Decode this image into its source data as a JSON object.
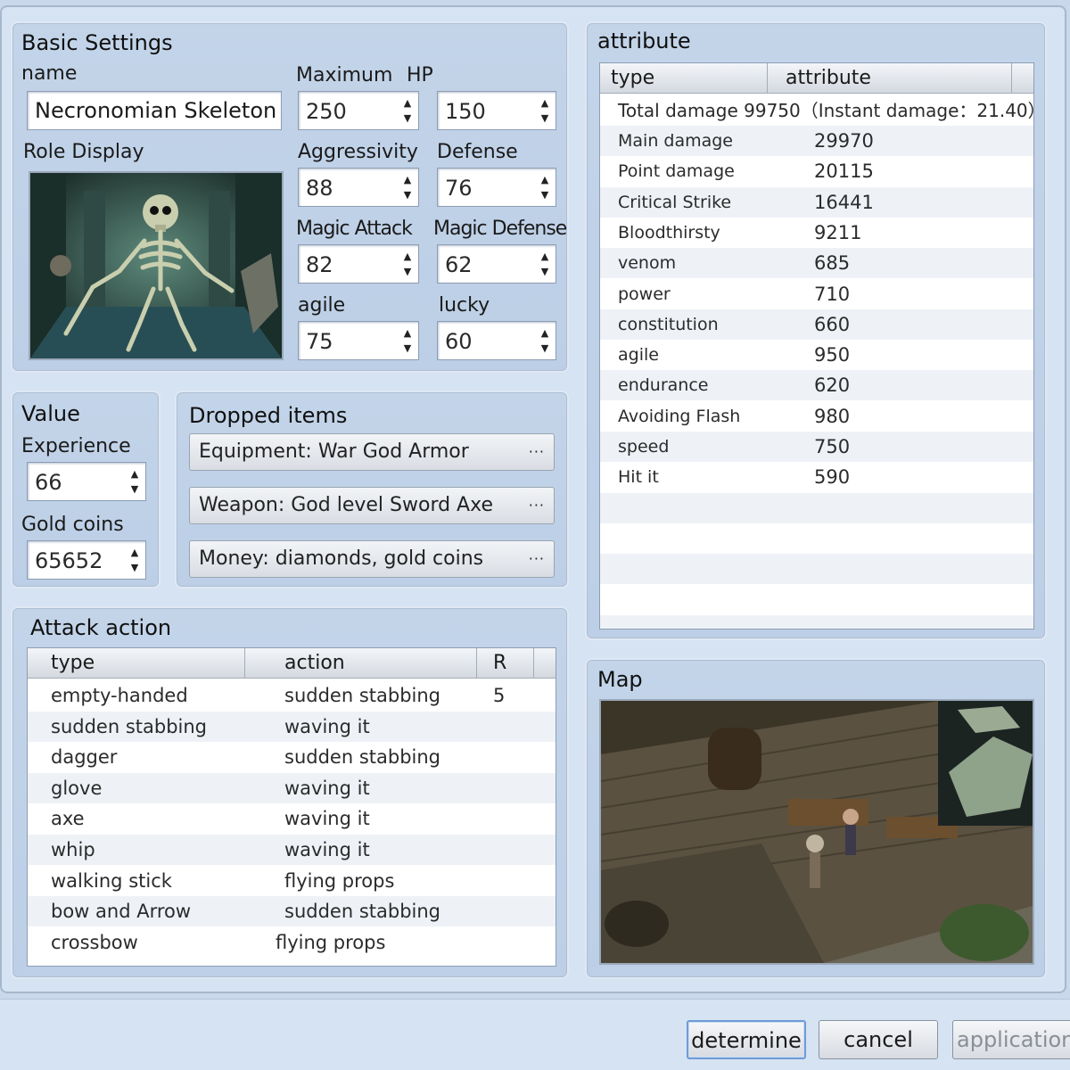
{
  "basic_settings": {
    "title": "Basic Settings",
    "name_label": "name",
    "name_value": "Necronomian Skeleton",
    "role_display_label": "Role Display",
    "maximum_label": "Maximum",
    "hp_label": "HP",
    "maximum_value": "250",
    "hp_value": "150",
    "aggressivity_label": "Aggressivity",
    "aggressivity_value": "88",
    "defense_label": "Defense",
    "defense_value": "76",
    "magic_attack_label": "Magic Attack",
    "magic_attack_value": "82",
    "magic_defense_label": "Magic Defense",
    "magic_defense_value": "62",
    "agile_label": "agile",
    "agile_value": "75",
    "lucky_label": "lucky",
    "lucky_value": "60"
  },
  "value": {
    "title": "Value",
    "experience_label": "Experience",
    "experience_value": "66",
    "gold_label": "Gold coins",
    "gold_value": "65652"
  },
  "dropped_items": {
    "title": "Dropped items",
    "items": [
      "Equipment: War God Armor",
      "Weapon: God level Sword Axe",
      "Money: diamonds, gold coins"
    ],
    "more_label": "···"
  },
  "attack_action": {
    "title": "Attack action",
    "columns": [
      "type",
      "action",
      "R"
    ],
    "rows": [
      {
        "type": "empty-handed",
        "action": "sudden stabbing",
        "r": "5"
      },
      {
        "type": "sudden stabbing",
        "action": "waving it",
        "r": ""
      },
      {
        "type": "dagger",
        "action": "sudden stabbing",
        "r": ""
      },
      {
        "type": "glove",
        "action": "waving it",
        "r": ""
      },
      {
        "type": "axe",
        "action": "waving it",
        "r": ""
      },
      {
        "type": "whip",
        "action": "waving it",
        "r": ""
      },
      {
        "type": "walking stick",
        "action": "flying props",
        "r": ""
      },
      {
        "type": "bow and Arrow",
        "action": "sudden stabbing",
        "r": ""
      },
      {
        "type": "crossbow",
        "action": "flying props",
        "r": ""
      }
    ]
  },
  "attribute": {
    "title": "attribute",
    "columns": [
      "type",
      "attribute"
    ],
    "total_row": "Total damage  99750（Instant damage：21.40）",
    "rows": [
      {
        "type": "Main damage",
        "value": "29970"
      },
      {
        "type": "Point damage",
        "value": "20115"
      },
      {
        "type": "Critical Strike",
        "value": "16441"
      },
      {
        "type": "Bloodthirsty",
        "value": "9211"
      },
      {
        "type": "venom",
        "value": "685"
      },
      {
        "type": "power",
        "value": "710"
      },
      {
        "type": "constitution",
        "value": "660"
      },
      {
        "type": "agile",
        "value": "950"
      },
      {
        "type": "endurance",
        "value": "620"
      },
      {
        "type": "Avoiding Flash",
        "value": "980"
      },
      {
        "type": "speed",
        "value": "750"
      },
      {
        "type": "Hit it",
        "value": "590"
      }
    ]
  },
  "map": {
    "title": "Map"
  },
  "footer": {
    "determine": "determine",
    "cancel": "cancel",
    "application": "application"
  },
  "colors": {
    "panel": "#c3d4e9",
    "window": "#d6e3f2",
    "primary_border": "#6f9bd6"
  }
}
